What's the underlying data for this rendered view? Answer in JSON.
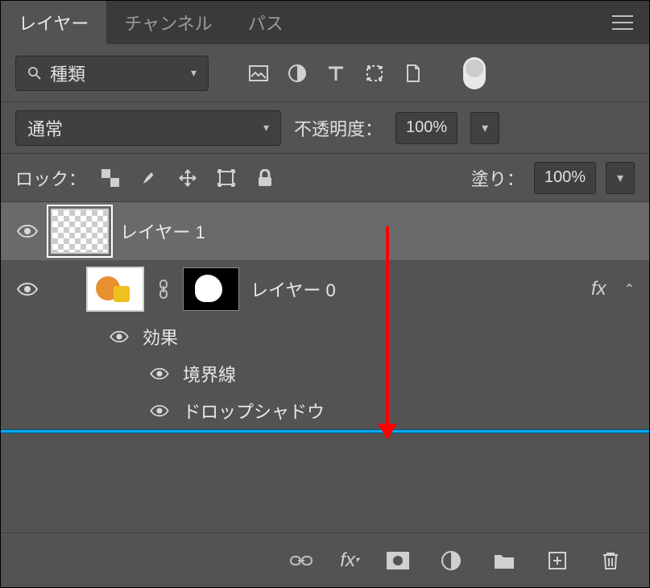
{
  "tabs": {
    "layers": "レイヤー",
    "channels": "チャンネル",
    "paths": "パス"
  },
  "filter": {
    "label": "種類"
  },
  "blend": {
    "mode": "通常",
    "opacity_label": "不透明度：",
    "opacity_value": "100%"
  },
  "lock": {
    "label": "ロック：",
    "fill_label": "塗り：",
    "fill_value": "100%"
  },
  "layers": [
    {
      "name": "レイヤー 1"
    },
    {
      "name": "レイヤー 0"
    }
  ],
  "effects": {
    "header": "効果",
    "stroke": "境界線",
    "drop_shadow": "ドロップシャドウ"
  },
  "fx_label": "fx"
}
